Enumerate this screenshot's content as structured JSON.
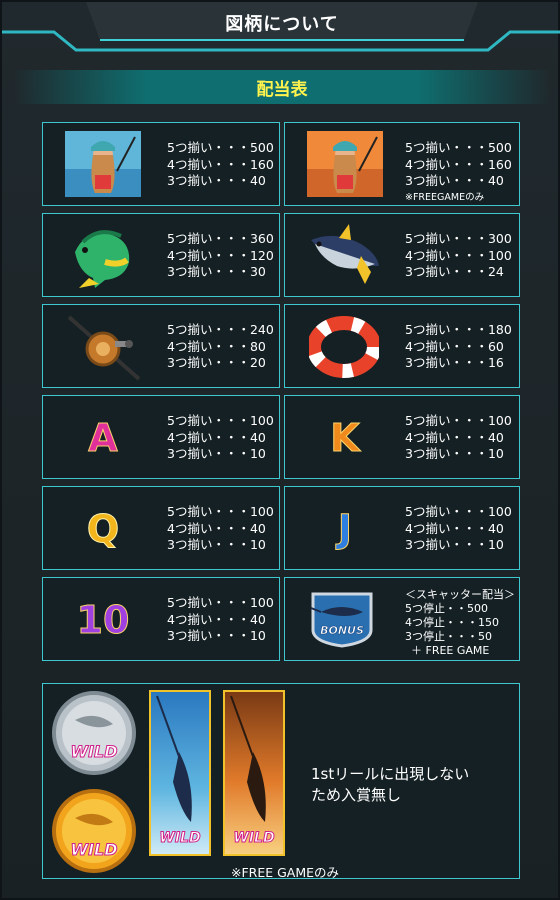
{
  "header": {
    "title": "図柄について"
  },
  "subheader": {
    "title": "配当表"
  },
  "symbols": [
    {
      "icon": "fishing-woman-icon",
      "lines": [
        "5つ揃い・・・500",
        "4つ揃い・・・160",
        "3つ揃い・・・40"
      ],
      "note": ""
    },
    {
      "icon": "fishing-woman-freegame-icon",
      "lines": [
        "5つ揃い・・・500",
        "4つ揃い・・・160",
        "3つ揃い・・・40"
      ],
      "note": "※FREEGAMEのみ"
    },
    {
      "icon": "mahi-mahi-fish-icon",
      "lines": [
        "5つ揃い・・・360",
        "4つ揃い・・・120",
        "3つ揃い・・・30"
      ],
      "note": ""
    },
    {
      "icon": "tuna-fish-icon",
      "lines": [
        "5つ揃い・・・300",
        "4つ揃い・・・100",
        "3つ揃い・・・24"
      ],
      "note": ""
    },
    {
      "icon": "fishing-reel-icon",
      "lines": [
        "5つ揃い・・・240",
        "4つ揃い・・・80",
        "3つ揃い・・・20"
      ],
      "note": ""
    },
    {
      "icon": "life-ring-icon",
      "lines": [
        "5つ揃い・・・180",
        "4つ揃い・・・60",
        "3つ揃い・・・16"
      ],
      "note": ""
    },
    {
      "icon": "letter-a-icon",
      "letter": "A",
      "lines": [
        "5つ揃い・・・100",
        "4つ揃い・・・40",
        "3つ揃い・・・10"
      ],
      "note": ""
    },
    {
      "icon": "letter-k-icon",
      "letter": "K",
      "lines": [
        "5つ揃い・・・100",
        "4つ揃い・・・40",
        "3つ揃い・・・10"
      ],
      "note": ""
    },
    {
      "icon": "letter-q-icon",
      "letter": "Q",
      "lines": [
        "5つ揃い・・・100",
        "4つ揃い・・・40",
        "3つ揃い・・・10"
      ],
      "note": ""
    },
    {
      "icon": "letter-j-icon",
      "letter": "J",
      "lines": [
        "5つ揃い・・・100",
        "4つ揃い・・・40",
        "3つ揃い・・・10"
      ],
      "note": ""
    },
    {
      "icon": "number-10-icon",
      "letter": "10",
      "lines": [
        "5つ揃い・・・100",
        "4つ揃い・・・40",
        "3つ揃い・・・10"
      ],
      "note": ""
    },
    {
      "icon": "bonus-scatter-icon",
      "lines": [
        "＜スキャッター配当＞",
        "5つ停止・・500",
        "4つ停止・・・150",
        "3つ停止・・・50",
        "＋ FREE GAME"
      ],
      "note": ""
    }
  ],
  "bonus_label": "BONUS",
  "wild": {
    "coin_label": "WILD",
    "card_label": "WILD",
    "description_lines": [
      "1stリールに出現しない",
      "ため入賞無し"
    ],
    "note": "※FREE GAMEのみ"
  },
  "colors": {
    "accent": "#3fc7cf",
    "title_yellow": "#fff34d",
    "letter_a": "#e0309a",
    "letter_k": "#f08a1c",
    "letter_q": "#f2b51c",
    "letter_j": "#2f7fe0",
    "letter_10": "#a040e0"
  }
}
